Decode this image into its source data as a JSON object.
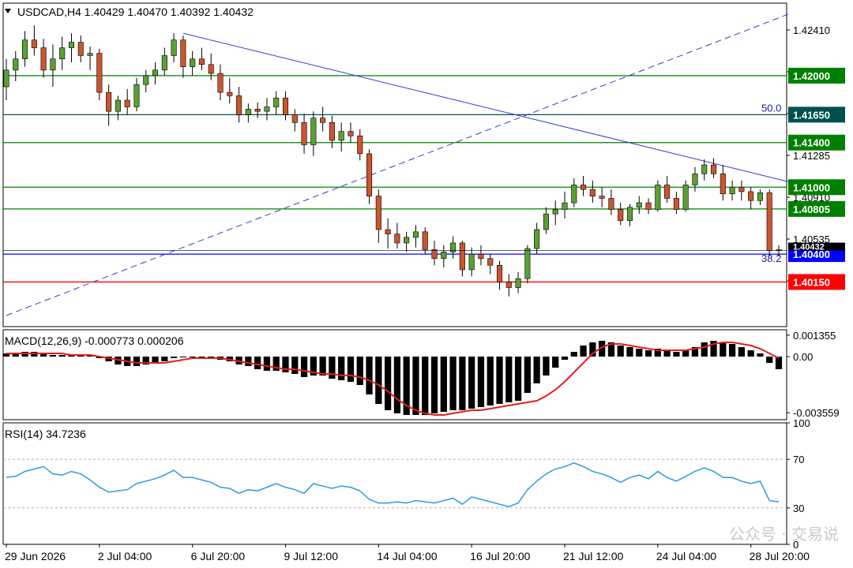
{
  "chart_data": {
    "type": "candlestick",
    "symbol_header": "USDCAD,H4  1.40429 1.40470 1.40392 1.40432",
    "price_axis": {
      "ylim": [
        1.3975,
        1.4265
      ],
      "tick_labels": [
        {
          "value": 1.4241,
          "text": "1.42410"
        },
        {
          "value": 1.42035,
          "text": "1.42035"
        },
        {
          "value": 1.4166,
          "text": "1.41660"
        },
        {
          "value": 1.41285,
          "text": "1.41285"
        },
        {
          "value": 1.4091,
          "text": "1.40910"
        },
        {
          "value": 1.40535,
          "text": "1.40535"
        },
        {
          "value": 1.4016,
          "text": "1.40160"
        }
      ]
    },
    "time_axis": {
      "labels": [
        {
          "index": 0,
          "text": "29 Jun 2026"
        },
        {
          "index": 10,
          "text": "2 Jul 04:00"
        },
        {
          "index": 20,
          "text": "6 Jul 20:00"
        },
        {
          "index": 30,
          "text": "9 Jul 12:00"
        },
        {
          "index": 40,
          "text": "14 Jul 04:00"
        },
        {
          "index": 50,
          "text": "16 Jul 20:00"
        },
        {
          "index": 60,
          "text": "21 Jul 12:00"
        },
        {
          "index": 70,
          "text": "24 Jul 04:00"
        },
        {
          "index": 80,
          "text": "28 Jul 20:00"
        }
      ]
    },
    "candles": [
      [
        1.419,
        1.4215,
        1.4178,
        1.4205
      ],
      [
        1.4205,
        1.4222,
        1.4195,
        1.4215
      ],
      [
        1.4215,
        1.424,
        1.4208,
        1.4232
      ],
      [
        1.4232,
        1.4245,
        1.4218,
        1.4225
      ],
      [
        1.4225,
        1.4233,
        1.4198,
        1.4205
      ],
      [
        1.4205,
        1.4228,
        1.419,
        1.4215
      ],
      [
        1.4215,
        1.4235,
        1.4205,
        1.4225
      ],
      [
        1.4225,
        1.4238,
        1.4212,
        1.423
      ],
      [
        1.423,
        1.4236,
        1.4212,
        1.4218
      ],
      [
        1.4218,
        1.4226,
        1.4205,
        1.422
      ],
      [
        1.422,
        1.4224,
        1.4178,
        1.4185
      ],
      [
        1.4185,
        1.4192,
        1.4155,
        1.4168
      ],
      [
        1.4168,
        1.4182,
        1.416,
        1.4178
      ],
      [
        1.4178,
        1.4188,
        1.4165,
        1.4172
      ],
      [
        1.4172,
        1.4198,
        1.4168,
        1.4192
      ],
      [
        1.4192,
        1.4205,
        1.4185,
        1.42
      ],
      [
        1.42,
        1.4212,
        1.4192,
        1.4205
      ],
      [
        1.4205,
        1.4225,
        1.42,
        1.4218
      ],
      [
        1.4218,
        1.4238,
        1.4212,
        1.4232
      ],
      [
        1.4232,
        1.4236,
        1.4198,
        1.4208
      ],
      [
        1.4208,
        1.4222,
        1.42,
        1.4215
      ],
      [
        1.4215,
        1.4225,
        1.4205,
        1.421
      ],
      [
        1.421,
        1.422,
        1.4196,
        1.4202
      ],
      [
        1.4202,
        1.421,
        1.4178,
        1.4185
      ],
      [
        1.4185,
        1.4198,
        1.4175,
        1.4182
      ],
      [
        1.4182,
        1.419,
        1.4158,
        1.4165
      ],
      [
        1.4165,
        1.4175,
        1.4158,
        1.417
      ],
      [
        1.417,
        1.4176,
        1.4162,
        1.4168
      ],
      [
        1.4168,
        1.418,
        1.416,
        1.4172
      ],
      [
        1.4172,
        1.4186,
        1.4165,
        1.418
      ],
      [
        1.418,
        1.4186,
        1.416,
        1.4165
      ],
      [
        1.4165,
        1.417,
        1.415,
        1.4158
      ],
      [
        1.4158,
        1.4166,
        1.413,
        1.4138
      ],
      [
        1.4138,
        1.4168,
        1.4128,
        1.4162
      ],
      [
        1.4162,
        1.4172,
        1.415,
        1.4158
      ],
      [
        1.4158,
        1.4164,
        1.4135,
        1.4142
      ],
      [
        1.4142,
        1.4158,
        1.4132,
        1.415
      ],
      [
        1.415,
        1.4158,
        1.414,
        1.4146
      ],
      [
        1.4146,
        1.4152,
        1.4124,
        1.413
      ],
      [
        1.413,
        1.4134,
        1.4085,
        1.4092
      ],
      [
        1.4092,
        1.4098,
        1.405,
        1.4062
      ],
      [
        1.4062,
        1.4072,
        1.4045,
        1.4058
      ],
      [
        1.4058,
        1.4068,
        1.4045,
        1.405
      ],
      [
        1.405,
        1.406,
        1.4042,
        1.4055
      ],
      [
        1.4055,
        1.4066,
        1.4046,
        1.406
      ],
      [
        1.406,
        1.4064,
        1.404,
        1.4044
      ],
      [
        1.4044,
        1.4052,
        1.403,
        1.4036
      ],
      [
        1.4036,
        1.4048,
        1.4028,
        1.4042
      ],
      [
        1.4042,
        1.4056,
        1.4036,
        1.405
      ],
      [
        1.405,
        1.4052,
        1.402,
        1.4026
      ],
      [
        1.4026,
        1.4046,
        1.402,
        1.404
      ],
      [
        1.404,
        1.4048,
        1.403,
        1.4036
      ],
      [
        1.4036,
        1.404,
        1.4022,
        1.403
      ],
      [
        1.403,
        1.4034,
        1.4008,
        1.4015
      ],
      [
        1.4015,
        1.4022,
        1.4002,
        1.401
      ],
      [
        1.401,
        1.4024,
        1.4005,
        1.4018
      ],
      [
        1.4018,
        1.4048,
        1.4014,
        1.4045
      ],
      [
        1.4045,
        1.4068,
        1.404,
        1.4062
      ],
      [
        1.4062,
        1.4082,
        1.4058,
        1.4076
      ],
      [
        1.4076,
        1.4088,
        1.4066,
        1.408
      ],
      [
        1.408,
        1.4096,
        1.4072,
        1.4086
      ],
      [
        1.4086,
        1.4108,
        1.4082,
        1.4102
      ],
      [
        1.4102,
        1.411,
        1.4092,
        1.4098
      ],
      [
        1.4098,
        1.4106,
        1.4086,
        1.4092
      ],
      [
        1.4092,
        1.41,
        1.4082,
        1.409
      ],
      [
        1.409,
        1.4098,
        1.4075,
        1.408
      ],
      [
        1.408,
        1.4086,
        1.4066,
        1.407
      ],
      [
        1.407,
        1.4085,
        1.4065,
        1.4082
      ],
      [
        1.4082,
        1.4092,
        1.4076,
        1.4086
      ],
      [
        1.4086,
        1.409,
        1.4076,
        1.408
      ],
      [
        1.408,
        1.4106,
        1.4078,
        1.4102
      ],
      [
        1.4102,
        1.411,
        1.4086,
        1.409
      ],
      [
        1.409,
        1.4096,
        1.4076,
        1.408
      ],
      [
        1.408,
        1.4106,
        1.4078,
        1.4102
      ],
      [
        1.4102,
        1.4118,
        1.4096,
        1.4112
      ],
      [
        1.4112,
        1.4125,
        1.4106,
        1.412
      ],
      [
        1.412,
        1.4126,
        1.4108,
        1.4112
      ],
      [
        1.4112,
        1.412,
        1.4088,
        1.4094
      ],
      [
        1.4094,
        1.4106,
        1.4088,
        1.41
      ],
      [
        1.41,
        1.4106,
        1.4088,
        1.4096
      ],
      [
        1.4096,
        1.41,
        1.408,
        1.4088
      ],
      [
        1.4088,
        1.4098,
        1.4084,
        1.4095
      ],
      [
        1.4095,
        1.4098,
        1.4038,
        1.4043
      ],
      [
        1.4043,
        1.4048,
        1.4038,
        1.4044
      ]
    ],
    "horizontal_levels": [
      {
        "value": 1.42,
        "text": "1.42000",
        "color": "#008000"
      },
      {
        "value": 1.4165,
        "text": "1.41650",
        "color": "#005050"
      },
      {
        "value": 1.414,
        "text": "1.41400",
        "color": "#008000"
      },
      {
        "value": 1.41,
        "text": "1.41000",
        "color": "#008000"
      },
      {
        "value": 1.40805,
        "text": "1.40805",
        "color": "#008000"
      },
      {
        "value": 1.404,
        "text": "1.40400",
        "color": "#0000ff"
      },
      {
        "value": 1.4015,
        "text": "1.40150",
        "color": "#ff0000"
      }
    ],
    "current_price": {
      "value": 1.40432,
      "text": "1.40432"
    },
    "fibo_labels": [
      {
        "text": "50.0",
        "value": 1.4165
      },
      {
        "text": "38.2",
        "value": 1.403
      }
    ],
    "trendlines": [
      {
        "style": "solid",
        "color": "#3a3acf",
        "from": [
          19,
          1.4238
        ],
        "to": [
          84,
          1.4105
        ]
      },
      {
        "style": "dashed",
        "color": "#3a3acf",
        "from": [
          0,
          1.3985
        ],
        "to": [
          84,
          1.4255
        ]
      }
    ],
    "macd": {
      "label": "MACD(12,26,9) -0.000773 0.000206",
      "ylim": [
        -0.004,
        0.0017
      ],
      "tick_labels": [
        {
          "value": 0.001355,
          "text": "0.001355"
        },
        {
          "value": 0.0,
          "text": "0.00"
        },
        {
          "value": -0.003559,
          "text": "-0.003559"
        }
      ],
      "hist": [
        0.0002,
        0.0002,
        0.0003,
        0.0003,
        0.0002,
        0.0001,
        0.0001,
        0.0001,
        0.0001,
        0.0001,
        -0.0001,
        -0.0003,
        -0.0005,
        -0.0006,
        -0.0006,
        -0.0005,
        -0.0004,
        -0.0003,
        -0.0001,
        0.0,
        0.0,
        -0.0001,
        -0.0001,
        -0.0002,
        -0.0003,
        -0.0005,
        -0.0006,
        -0.0008,
        -0.0009,
        -0.0009,
        -0.001,
        -0.0011,
        -0.0013,
        -0.0012,
        -0.0012,
        -0.0014,
        -0.0015,
        -0.0016,
        -0.0018,
        -0.0024,
        -0.003,
        -0.0034,
        -0.0036,
        -0.0037,
        -0.0037,
        -0.0037,
        -0.0036,
        -0.0035,
        -0.0034,
        -0.0034,
        -0.0033,
        -0.0032,
        -0.0031,
        -0.003,
        -0.0029,
        -0.0028,
        -0.0023,
        -0.0017,
        -0.0012,
        -0.0007,
        -0.0002,
        0.0003,
        0.0007,
        0.0009,
        0.001,
        0.0009,
        0.0007,
        0.0006,
        0.0005,
        0.0004,
        0.0005,
        0.0004,
        0.0003,
        0.0004,
        0.0006,
        0.0009,
        0.001,
        0.0009,
        0.0008,
        0.0006,
        0.0004,
        0.0002,
        -0.0004,
        -0.0008
      ],
      "signal": [
        0.0002,
        0.0002,
        0.0002,
        0.0002,
        0.0002,
        0.0002,
        0.0002,
        0.0001,
        0.0001,
        0.0001,
        0.0,
        -0.0001,
        -0.0002,
        -0.0003,
        -0.0004,
        -0.0004,
        -0.0004,
        -0.0004,
        -0.0003,
        -0.0002,
        -0.0001,
        -0.0001,
        -0.0001,
        -0.0001,
        -0.0002,
        -0.0003,
        -0.0004,
        -0.0005,
        -0.0006,
        -0.0007,
        -0.0008,
        -0.0008,
        -0.0009,
        -0.001,
        -0.0011,
        -0.0011,
        -0.0012,
        -0.0012,
        -0.0013,
        -0.0015,
        -0.0018,
        -0.0022,
        -0.0027,
        -0.0031,
        -0.0034,
        -0.0036,
        -0.0037,
        -0.0037,
        -0.0036,
        -0.0035,
        -0.0034,
        -0.0034,
        -0.0033,
        -0.0032,
        -0.0031,
        -0.003,
        -0.0029,
        -0.0028,
        -0.0025,
        -0.0021,
        -0.0016,
        -0.001,
        -0.0004,
        0.0002,
        0.0006,
        0.0008,
        0.0008,
        0.0007,
        0.0006,
        0.0005,
        0.0004,
        0.0004,
        0.0004,
        0.0004,
        0.0005,
        0.0006,
        0.0008,
        0.0009,
        0.0009,
        0.0008,
        0.0007,
        0.0005,
        0.0002,
        -0.0001
      ]
    },
    "rsi": {
      "label": "RSI(14) 34.7236",
      "ylim": [
        0,
        100
      ],
      "tick_labels": [
        {
          "value": 100,
          "text": "100"
        },
        {
          "value": 70,
          "text": "70"
        },
        {
          "value": 30,
          "text": "30"
        },
        {
          "value": 0,
          "text": "0"
        }
      ],
      "levels": [
        70,
        30
      ],
      "values": [
        55,
        56,
        60,
        62,
        64,
        58,
        57,
        60,
        58,
        53,
        47,
        43,
        44,
        45,
        50,
        52,
        54,
        57,
        61,
        55,
        55,
        53,
        51,
        47,
        46,
        42,
        45,
        44,
        47,
        50,
        47,
        45,
        42,
        50,
        48,
        46,
        48,
        47,
        44,
        37,
        34,
        34,
        35,
        34,
        36,
        35,
        34,
        36,
        38,
        33,
        39,
        37,
        35,
        33,
        31,
        34,
        45,
        52,
        58,
        62,
        64,
        67,
        64,
        60,
        58,
        55,
        51,
        55,
        57,
        54,
        60,
        55,
        52,
        56,
        60,
        63,
        60,
        55,
        55,
        52,
        50,
        52,
        36,
        35
      ]
    },
    "colors": {
      "bull": "#5aa033",
      "bear": "#cc5530",
      "macd_hist": "#000000",
      "macd_signal": "#e02020",
      "rsi_line": "#2a9ce0"
    }
  },
  "watermark": {
    "text": "公众号 · 交易说"
  }
}
